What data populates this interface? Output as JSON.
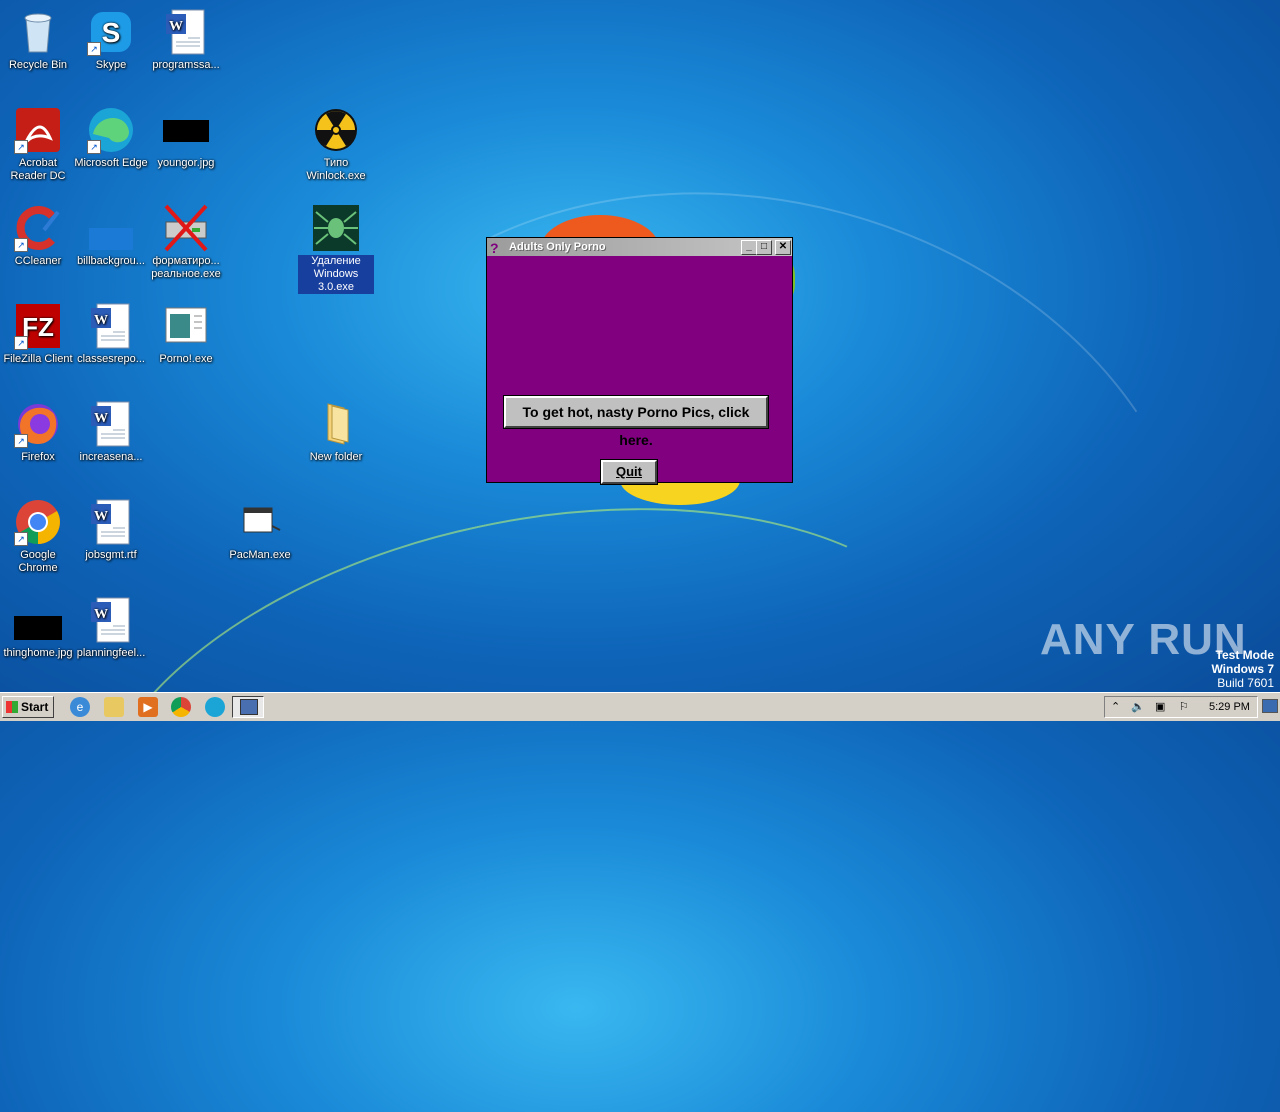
{
  "desktop": {
    "icons": [
      {
        "label": "Recycle Bin"
      },
      {
        "label": "Skype"
      },
      {
        "label": "programssa..."
      },
      {
        "label": "Acrobat Reader DC"
      },
      {
        "label": "Microsoft Edge"
      },
      {
        "label": "youngor.jpg"
      },
      {
        "label": "Типо Winlock.exe"
      },
      {
        "label": "CCleaner"
      },
      {
        "label": "billbackgrou..."
      },
      {
        "label": "форматиро... реальное.exe"
      },
      {
        "label": "Удаление Windows 3.0.exe"
      },
      {
        "label": "FileZilla Client"
      },
      {
        "label": "classesrepo..."
      },
      {
        "label": "Porno!.exe"
      },
      {
        "label": "Firefox"
      },
      {
        "label": "increasena..."
      },
      {
        "label": "New folder"
      },
      {
        "label": "Google Chrome"
      },
      {
        "label": "jobsgmt.rtf"
      },
      {
        "label": "PacMan.exe"
      },
      {
        "label": "thinghome.jpg"
      },
      {
        "label": "planningfeel..."
      }
    ]
  },
  "dialog": {
    "title": "Adults Only Porno",
    "main_button": "To get hot, nasty Porno Pics, click here.",
    "quit_button": "Quit"
  },
  "taskbar": {
    "start_label": "Start",
    "clock": "5:29 PM"
  },
  "watermark": "ANY RUN",
  "test_mode": {
    "line1": "Test Mode",
    "line2": "Windows 7",
    "line3": "Build 7601"
  }
}
